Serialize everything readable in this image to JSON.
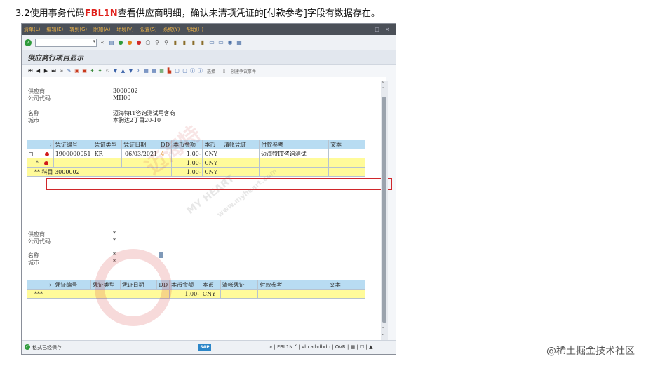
{
  "caption": {
    "prefix": "3.2使用事务代码",
    "code": "FBL1N",
    "suffix": "查看供应商明细，确认未清项凭证的[付款参考]字段有数据存在。"
  },
  "menu": [
    "清单(L)",
    "编辑(E)",
    "转到(G)",
    "附加(A)",
    "环境(V)",
    "设置(S)",
    "系统(Y)",
    "帮助(H)"
  ],
  "window_controls": "_ □ ×",
  "screen_title": "供应商行项目显示",
  "toolbar2_texts": [
    "选择",
    "创建争议事件"
  ],
  "section1": {
    "vendor_label": "供应商",
    "vendor_value": "3000002",
    "company_label": "公司代码",
    "company_value": "MH00",
    "name_label": "名称",
    "name_value": "迈海特IT咨询测试用客商",
    "city_label": "城市",
    "city_value": "本驹达2丁目20-10"
  },
  "table_headers": [
    "",
    "凭证编号",
    "凭证类型",
    "凭证日期",
    "DD",
    "本币金额",
    "本币",
    "清帐凭证",
    "付款参考",
    "文本"
  ],
  "table1_rows": [
    {
      "doc_no": "1900000051",
      "doc_type": "KR",
      "doc_date": "06/03/2021",
      "dd": "4",
      "amount": "1.00-",
      "currency": "CNY",
      "clearing": "",
      "pay_ref": "迈海特IT咨询测试",
      "text": ""
    },
    {
      "marker": "*",
      "amount": "1.00-",
      "currency": "CNY"
    },
    {
      "label": "** 科目 3000002",
      "amount": "1.00-",
      "currency": "CNY"
    }
  ],
  "section2": {
    "vendor_label": "供应商",
    "vendor_value": "*",
    "company_label": "公司代码",
    "company_value": "*",
    "name_label": "名称",
    "name_value": "*",
    "city_label": "城市",
    "city_value": "*"
  },
  "table2_total": {
    "label": "***",
    "amount": "1.00-",
    "currency": "CNY"
  },
  "status": {
    "message": "格式已经保存",
    "logo": "SAP",
    "sysinfo": "» | FBL1N ˅ | vhcalhdbdb | OVR | ▦ | ☐ | ▲"
  },
  "watermark": [
    "迈海特",
    "MY HEART",
    "www.myheart.com"
  ],
  "footer": "@稀土掘金技术社区"
}
